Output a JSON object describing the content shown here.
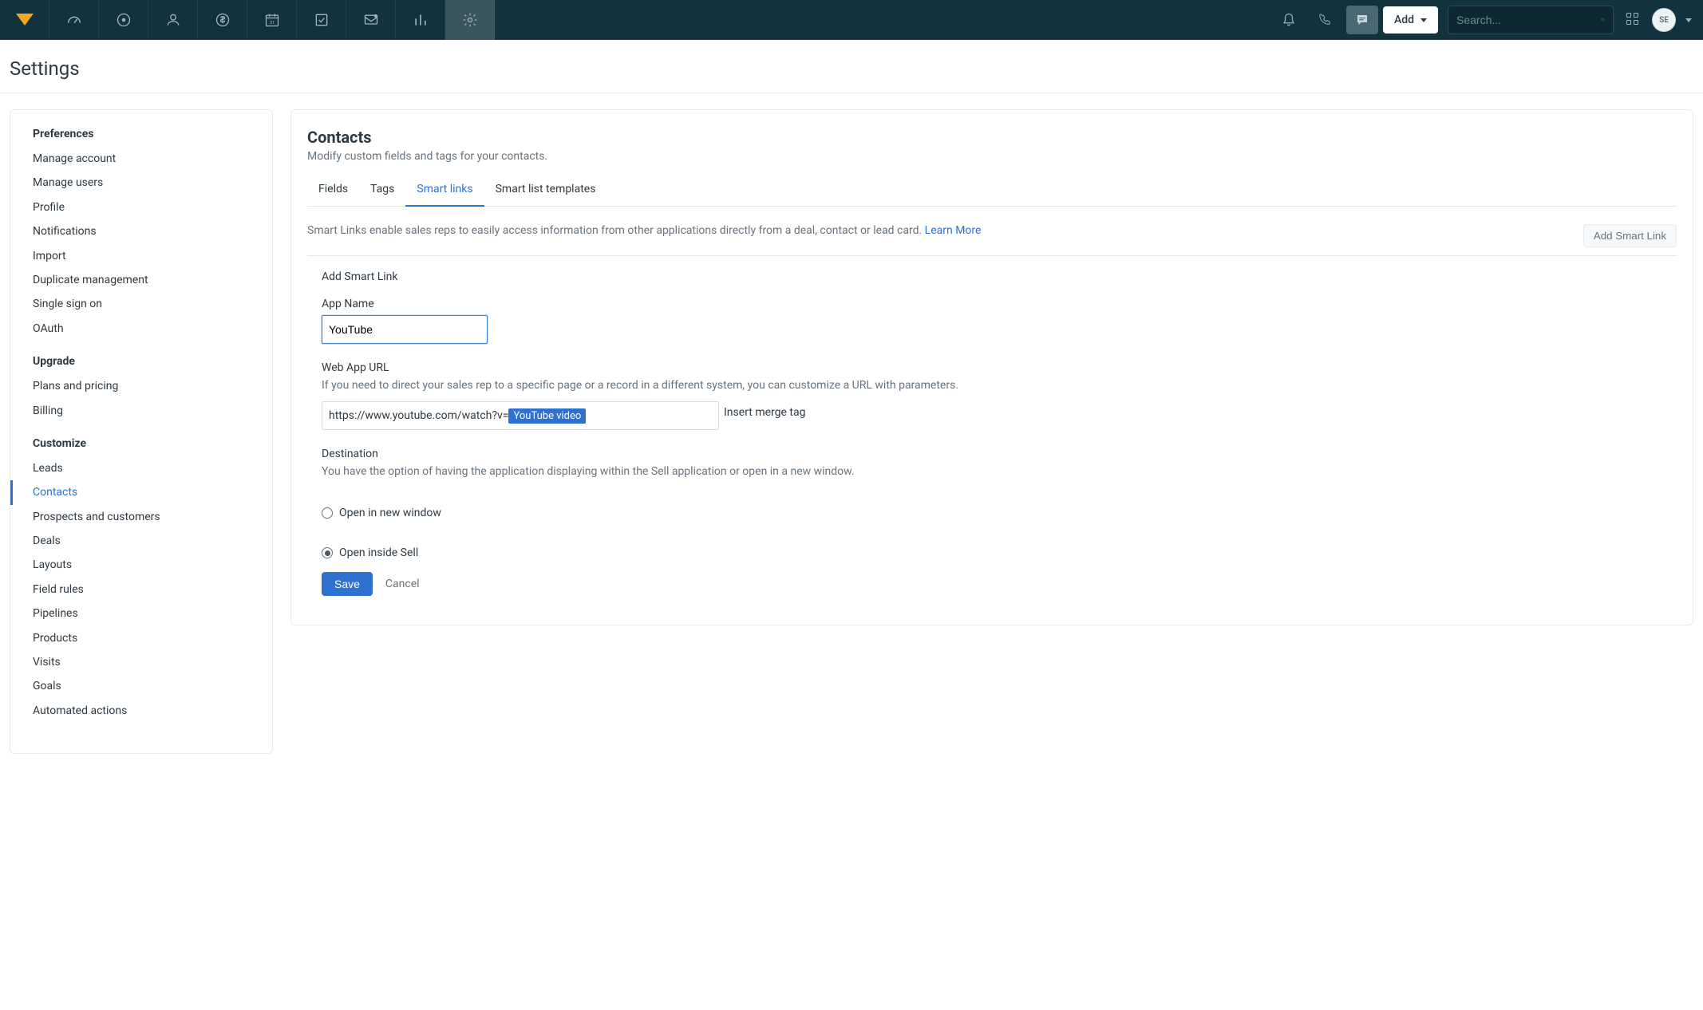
{
  "topnav": {
    "search_placeholder": "Search...",
    "add_label": "Add",
    "avatar_initials": "SE"
  },
  "page": {
    "title": "Settings"
  },
  "sidebar": {
    "groups": [
      {
        "title": "Preferences",
        "items": [
          "Manage account",
          "Manage users",
          "Profile",
          "Notifications",
          "Import",
          "Duplicate management",
          "Single sign on",
          "OAuth"
        ]
      },
      {
        "title": "Upgrade",
        "items": [
          "Plans and pricing",
          "Billing"
        ]
      },
      {
        "title": "Customize",
        "items": [
          "Leads",
          "Contacts",
          "Prospects and customers",
          "Deals",
          "Layouts",
          "Field rules",
          "Pipelines",
          "Products",
          "Visits",
          "Goals",
          "Automated actions"
        ],
        "active_index": 1
      }
    ]
  },
  "main": {
    "heading": "Contacts",
    "subtitle": "Modify custom fields and tags for your contacts.",
    "tabs": [
      "Fields",
      "Tags",
      "Smart links",
      "Smart list templates"
    ],
    "active_tab_index": 2,
    "desc_text": "Smart Links enable sales reps to easily access information from other applications directly from a deal, contact or lead card. ",
    "learn_more": "Learn More",
    "add_smart_link_btn": "Add Smart Link",
    "form": {
      "section_title": "Add Smart Link",
      "app_name_label": "App Name",
      "app_name_value": "YouTube",
      "web_url_label": "Web App URL",
      "web_url_help": "If you need to direct your sales rep to a specific page or a record in a different system, you can customize a URL with parameters.",
      "url_prefix": "https://www.youtube.com/watch?v=",
      "merge_tag": "YouTube video",
      "insert_merge_label": "Insert merge tag",
      "destination_label": "Destination",
      "destination_help": "You have the option of having the application displaying within the Sell application or open in a new window.",
      "radio_new_window": "Open in new window",
      "radio_inside_sell": "Open inside Sell",
      "selected_radio": "inside",
      "save_label": "Save",
      "cancel_label": "Cancel"
    }
  }
}
